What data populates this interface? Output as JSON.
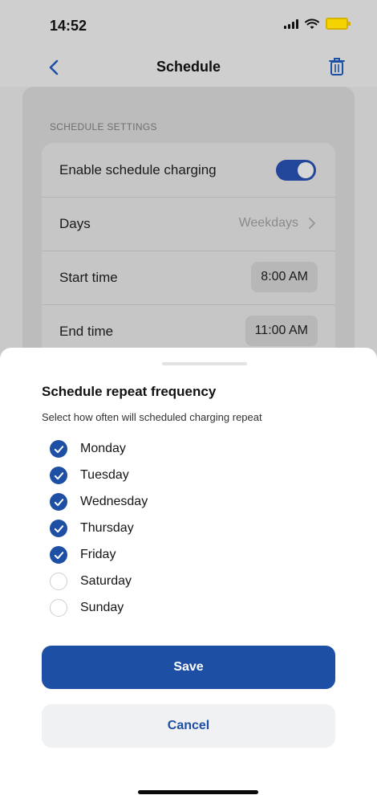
{
  "status": {
    "time": "14:52"
  },
  "nav": {
    "title": "Schedule"
  },
  "settings": {
    "section_label": "SCHEDULE SETTINGS",
    "enable_label": "Enable schedule charging",
    "enable_state": true,
    "days_label": "Days",
    "days_value": "Weekdays",
    "start_label": "Start time",
    "start_value": "8:00 AM",
    "end_label": "End time",
    "end_value": "11:00 AM"
  },
  "sheet": {
    "title": "Schedule repeat frequency",
    "subtitle": "Select how often will scheduled charging repeat",
    "days": [
      {
        "label": "Monday",
        "checked": true
      },
      {
        "label": "Tuesday",
        "checked": true
      },
      {
        "label": "Wednesday",
        "checked": true
      },
      {
        "label": "Thursday",
        "checked": true
      },
      {
        "label": "Friday",
        "checked": true
      },
      {
        "label": "Saturday",
        "checked": false
      },
      {
        "label": "Sunday",
        "checked": false
      }
    ],
    "save_label": "Save",
    "cancel_label": "Cancel"
  },
  "icons": {
    "back": "chevron-left-icon",
    "trash": "trash-icon",
    "days_chevron": "chevron-right-icon",
    "check": "checkmark-icon"
  },
  "colors": {
    "primary": "#1d4fa5",
    "toggle_on": "#22479a"
  }
}
